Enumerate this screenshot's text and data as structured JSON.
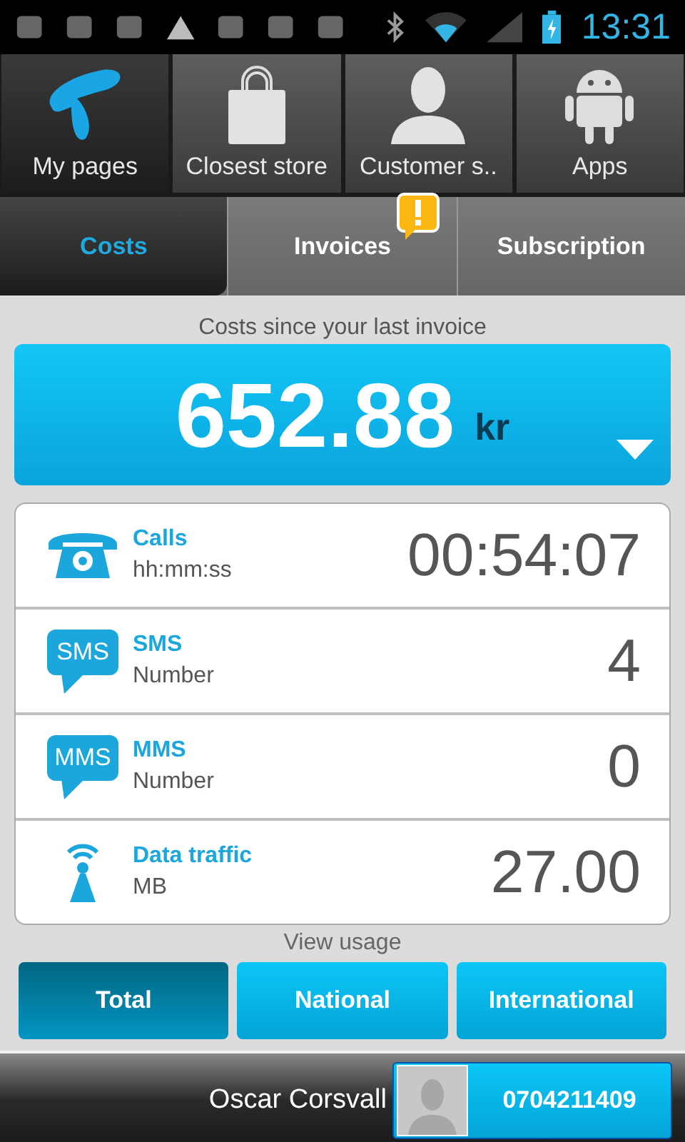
{
  "status_bar": {
    "time": "13:31"
  },
  "nav": [
    {
      "label": "My pages",
      "kind": "logo",
      "selected": true
    },
    {
      "label": "Closest store",
      "kind": "bag",
      "selected": false
    },
    {
      "label": "Customer s..",
      "kind": "person",
      "selected": false
    },
    {
      "label": "Apps",
      "kind": "android",
      "selected": false
    }
  ],
  "tabs": [
    {
      "label": "Costs",
      "selected": true,
      "alert": false
    },
    {
      "label": "Invoices",
      "selected": false,
      "alert": true
    },
    {
      "label": "Subscription",
      "selected": false,
      "alert": false
    }
  ],
  "costs": {
    "caption": "Costs since your last invoice",
    "amount": "652.88",
    "currency": "kr"
  },
  "usage": [
    {
      "kind": "phone",
      "title": "Calls",
      "unit": "hh:mm:ss",
      "value": "00:54:07"
    },
    {
      "kind": "bubble",
      "icon_text": "SMS",
      "title": "SMS",
      "unit": "Number",
      "value": "4"
    },
    {
      "kind": "bubble",
      "icon_text": "MMS",
      "title": "MMS",
      "unit": "Number",
      "value": "0"
    },
    {
      "kind": "antenna",
      "title": "Data traffic",
      "unit": "MB",
      "value": "27.00"
    }
  ],
  "view_usage": {
    "caption": "View usage",
    "buttons": [
      {
        "label": "Total",
        "selected": true
      },
      {
        "label": "National",
        "selected": false
      },
      {
        "label": "International",
        "selected": false
      }
    ]
  },
  "footer": {
    "name": "Oscar Corsvall",
    "number": "0704211409"
  }
}
